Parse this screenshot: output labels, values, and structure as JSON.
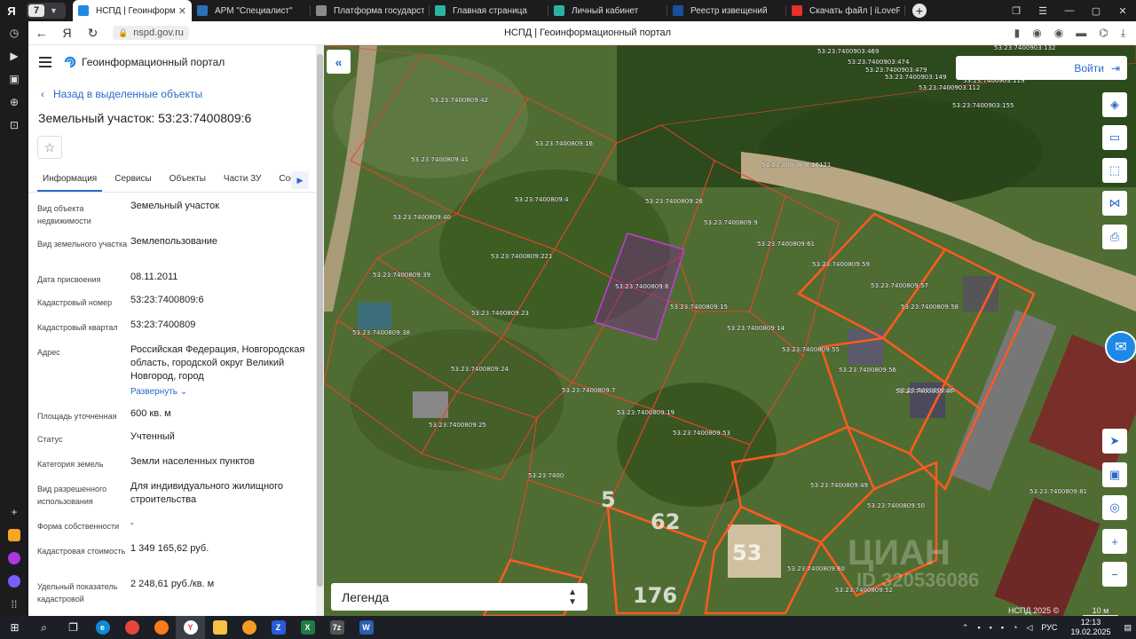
{
  "browser": {
    "tab_count": "7",
    "tabs": [
      {
        "label": "НСПД | Геоинформационный портал",
        "active": true,
        "color": "#1e88e5"
      },
      {
        "label": "АРМ \"Специалист\"",
        "active": false,
        "color": "#2b6fb8"
      },
      {
        "label": "Платформа государственных",
        "active": false,
        "color": "#8a8a8a"
      },
      {
        "label": "Главная страница",
        "active": false,
        "color": "#2bb3a0"
      },
      {
        "label": "Личный кабинет",
        "active": false,
        "color": "#2bb3a0"
      },
      {
        "label": "Реестр извещений",
        "active": false,
        "color": "#1a4fa0"
      },
      {
        "label": "Скачать файл | iLovePDF",
        "active": false,
        "color": "#e5322d"
      }
    ],
    "url": "nspd.gov.ru",
    "page_title": "НСПД | Геоинформационный портал"
  },
  "panel": {
    "brand": "Геоинформационный портал",
    "back_link": "Назад в выделенные объекты",
    "title": "Земельный участок: 53:23:7400809:6",
    "tabs": [
      "Информация",
      "Сервисы",
      "Объекты",
      "Части ЗУ",
      "Состав"
    ],
    "expand_label": "Развернуть",
    "properties": [
      {
        "key": "Вид объекта недвижимости",
        "value": "Земельный участок"
      },
      {
        "key": "Вид земельного участка",
        "value": "Землепользование"
      },
      {
        "key": "Дата присвоения",
        "value": "08.11.2011"
      },
      {
        "key": "Кадастровый номер",
        "value": "53:23:7400809:6"
      },
      {
        "key": "Кадастровый квартал",
        "value": "53:23:7400809"
      },
      {
        "key": "Адрес",
        "value": "Российская Федерация, Новгородская область, городской округ Великий Новгород, город"
      },
      {
        "key": "Площадь уточненная",
        "value": "600 кв. м"
      },
      {
        "key": "Статус",
        "value": "Учтенный"
      },
      {
        "key": "Категория земель",
        "value": "Земли населенных пунктов"
      },
      {
        "key": "Вид разрешенного использования",
        "value": "Для индивидуального жилищного строительства"
      },
      {
        "key": "Форма собственности",
        "value": "-"
      },
      {
        "key": "Кадастровая стоимость",
        "value": "1 349 165,62 руб."
      },
      {
        "key": "Удельный показатель кадастровой",
        "value": "2 248,61 руб./кв. м"
      }
    ]
  },
  "map": {
    "login_label": "Войти",
    "legend_label": "Легенда",
    "copyright": "НСПД 2025 ©",
    "scale_label": "10 м",
    "watermark": "ЦИАН",
    "watermark_id": "ID 320536086",
    "parcel_labels": [
      "53:23:7400809:42",
      "53:23:7400809:16",
      "53:23:7400809:41",
      "53:23:7400809:4",
      "53:23:7400809:40",
      "53:23:7400809:26",
      "53:23:7400809:221",
      "53:23:7400809:9",
      "53:23:0000000:16121",
      "53:23:7400809:39",
      "53:23:7400809:6",
      "53:23:7400809:15",
      "53:23:7400809:61",
      "53:23:7400809:59",
      "53:23:7400809:57",
      "53:23:7400809:23",
      "53:23:7400809:14",
      "53:23:7400809:38",
      "53:23:7400809:55",
      "53:23:7400809:56",
      "53:23:7400809:58",
      "53:23:7400809:24",
      "53:23:7400809:36",
      "53:23:7400809:7",
      "53:23:7400809:47",
      "53:23:7400809:19",
      "53:23:7400809:25",
      "53:23:7400809:53",
      "53:23:7400",
      "53:23:7400809:49",
      "53:23:7400809:50",
      "53:23:7400809:60",
      "53:23:7400809:52",
      "53:23:7400809:81",
      "53:23:7400903:469",
      "53:23:7400903:474",
      "53:23:7400903:479",
      "53:23:7400903:149",
      "53:23:7400903:112",
      "53:23:7400903:119",
      "53:23:7400903:155",
      "53:23:7400903:132"
    ],
    "big_numbers": [
      "5",
      "62",
      "53",
      "176"
    ]
  },
  "taskbar": {
    "lang": "РУС",
    "time": "12:13",
    "date": "19.02.2025"
  }
}
